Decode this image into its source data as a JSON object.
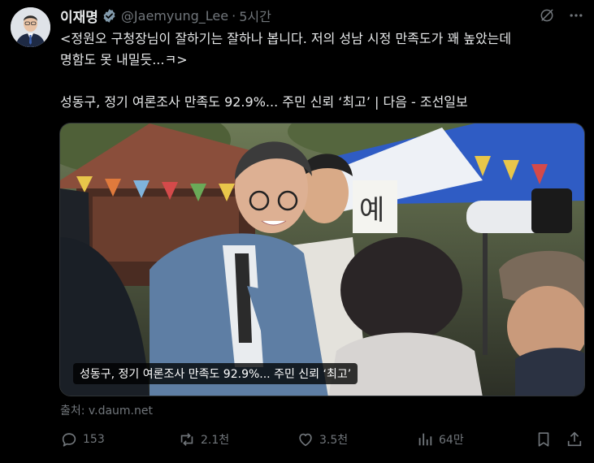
{
  "tweet": {
    "author_name": "이재명",
    "handle": "@Jaemyung_Lee",
    "separator": "·",
    "time_ago": "5시간",
    "text": "<정원오 구청장님이 잘하기는 잘하나 봅니다. 저의 성남 시정 만족도가 꽤 높았는데\n명함도 못 내밀듯...ㅋ>\n\n성동구, 정기 여론조사 만족도 92.9%... 주민 신뢰 ‘최고’ | 다음 - 조선일보"
  },
  "card": {
    "caption": "성동구, 정기 여론조사 만족도 92.9%... 주민 신뢰 ‘최고’",
    "source": "출처: v.daum.net",
    "photo_sign": "예"
  },
  "actions": {
    "replies": "153",
    "reposts": "2.1천",
    "likes": "3.5천",
    "views": "64만"
  },
  "icons": [
    "verified-badge-icon",
    "grok-icon",
    "more-icon",
    "reply-icon",
    "repost-icon",
    "like-icon",
    "views-icon",
    "bookmark-icon",
    "share-icon"
  ],
  "colors": {
    "background": "#000000",
    "text": "#e7e9ea",
    "muted": "#71767b",
    "verified": "#829aab"
  }
}
